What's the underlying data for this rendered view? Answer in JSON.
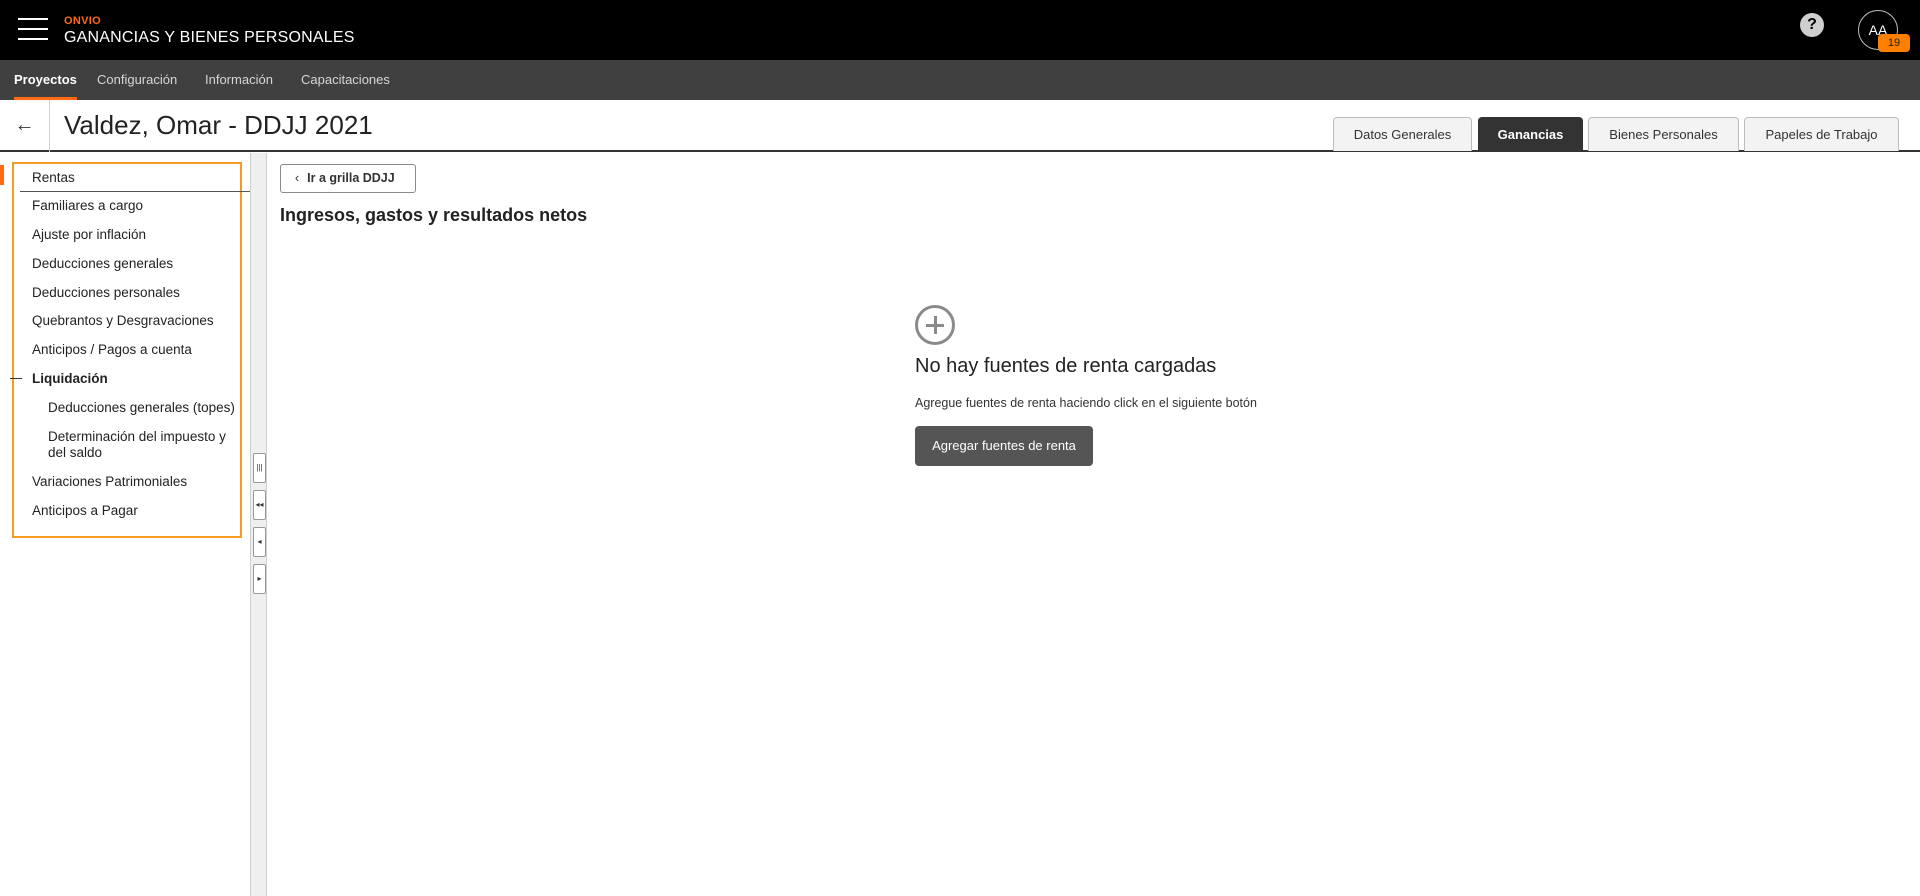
{
  "app": {
    "brand_small": "ONVIO",
    "brand_title": "GANANCIAS Y BIENES PERSONALES",
    "help_icon": "?",
    "avatar_initials": "AA",
    "notification_count": "19"
  },
  "nav": {
    "items": [
      {
        "label": "Proyectos",
        "active": true
      },
      {
        "label": "Configuración"
      },
      {
        "label": "Información"
      },
      {
        "label": "Capacitaciones"
      }
    ]
  },
  "header": {
    "back_icon": "←",
    "title": "Valdez, Omar - DDJJ 2021",
    "tabs": [
      {
        "label": "Datos Generales"
      },
      {
        "label": "Ganancias",
        "active": true
      },
      {
        "label": "Bienes Personales"
      },
      {
        "label": "Papeles de Trabajo"
      }
    ]
  },
  "sidebar": {
    "items": [
      {
        "label": "Rentas",
        "active": true
      },
      {
        "label": "Familiares a cargo"
      },
      {
        "label": "Ajuste por inflación"
      },
      {
        "label": "Deducciones generales"
      },
      {
        "label": "Deducciones personales"
      },
      {
        "label": "Quebrantos y Desgravaciones"
      },
      {
        "label": "Anticipos / Pagos a cuenta"
      },
      {
        "label": "Liquidación",
        "expanded": true
      },
      {
        "label": "Deducciones generales (topes)"
      },
      {
        "label": "Determinación del impuesto y"
      },
      {
        "label": "del saldo"
      },
      {
        "label": "Variaciones Patrimoniales"
      },
      {
        "label": "Anticipos a Pagar"
      }
    ]
  },
  "main": {
    "grid_button": "Ir a grilla DDJJ",
    "grid_button_icon": "‹",
    "section_title": "Ingresos, gastos y resultados netos",
    "empty_title": "No hay fuentes de renta cargadas",
    "empty_desc": "Agregue fuentes de renta haciendo click en el siguiente botón",
    "add_button": "Agregar fuentes de renta"
  },
  "colors": {
    "accent": "#ff6a13",
    "highlight_border": "#f39c1f",
    "topbar": "#000000",
    "navbar": "#404040"
  }
}
